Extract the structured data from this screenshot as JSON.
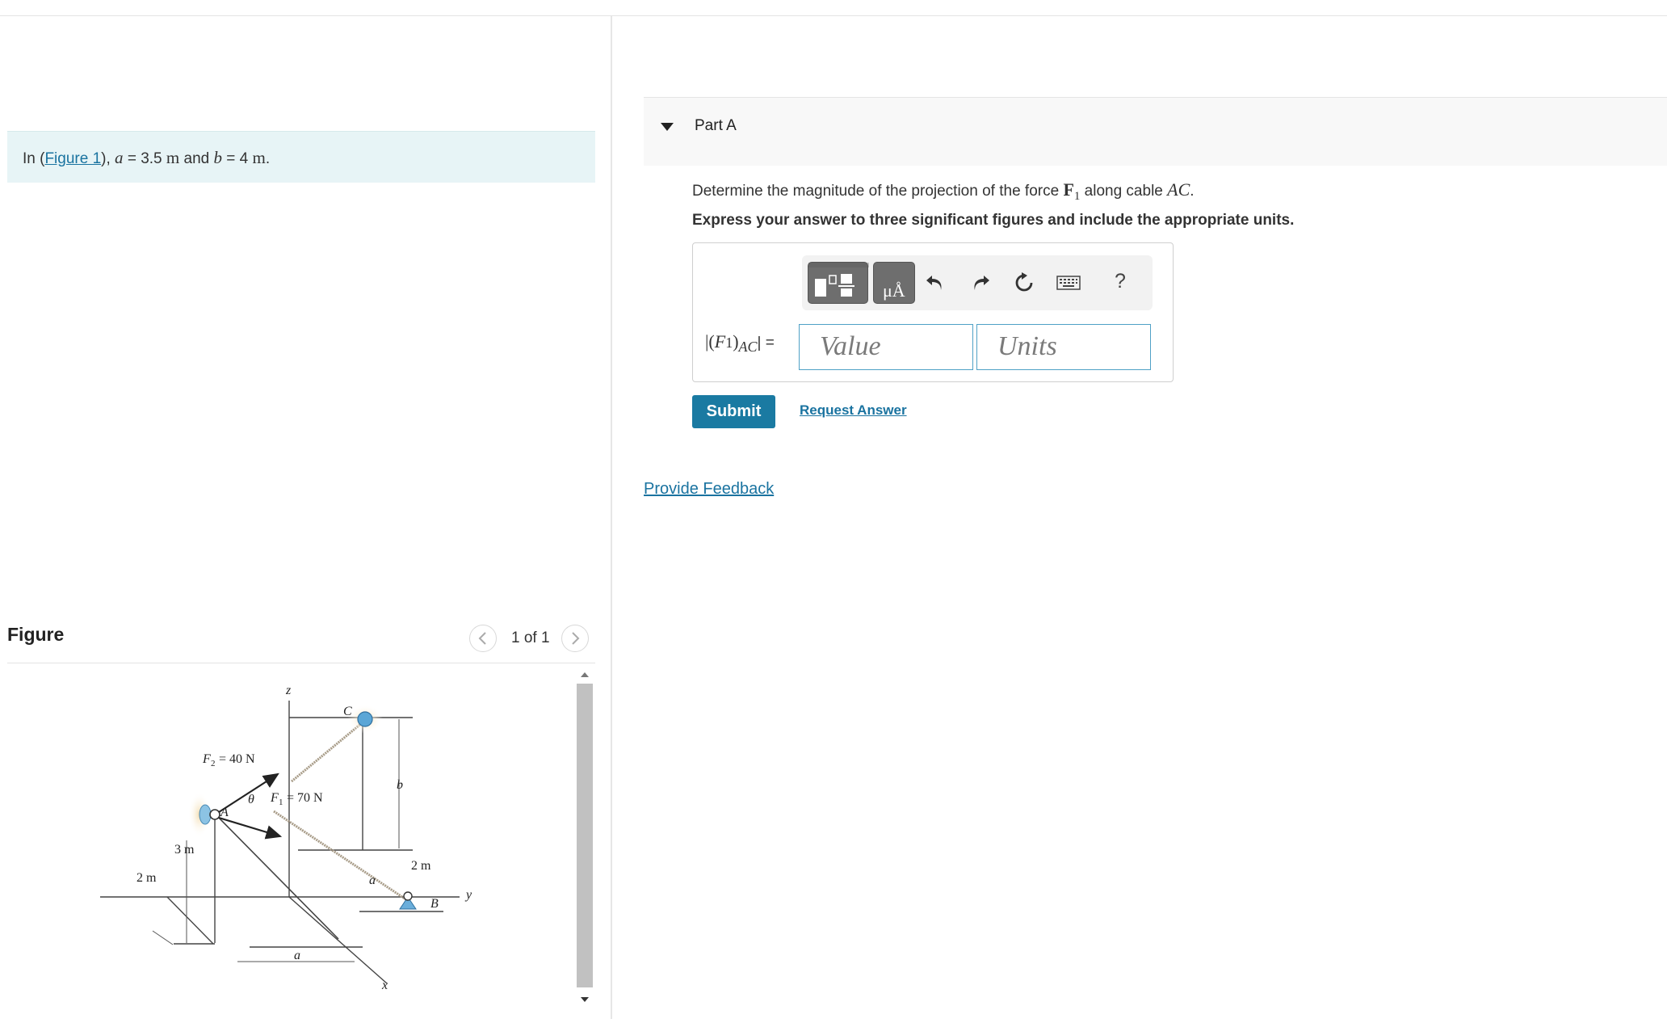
{
  "intro": {
    "prefix": "In (",
    "figure_link": "Figure 1",
    "mid1": "), ",
    "a_sym": "a",
    "eq_a": " = 3.5 ",
    "unit_a": "m",
    "and_text": " and ",
    "b_sym": "b",
    "eq_b": " = 4 ",
    "unit_b": "m",
    "end": "."
  },
  "figure": {
    "title": "Figure",
    "counter": "1 of 1",
    "labels": {
      "z": "z",
      "c": "C",
      "f2": "= 40 N",
      "f2_sym": "F",
      "f2_sub": "2",
      "b": "b",
      "theta": "θ",
      "f1_sym": "F",
      "f1_sub": "1",
      "f1": "= 70 N",
      "a_point": "A",
      "three_m": "3 m",
      "two_m_right": "2 m",
      "y": "y",
      "b_point": "B",
      "two_m_left": "2 m",
      "a_dim_right": "a",
      "a_dim_bottom": "a",
      "x": "x"
    }
  },
  "part_a": {
    "title": "Part A",
    "question_prefix": "Determine the magnitude of the projection of the force ",
    "force_sym": "F",
    "force_sub": "1",
    "question_mid": " along cable ",
    "cable": "AC",
    "question_end": ".",
    "instructions": "Express your answer to three significant figures and include the appropriate units.",
    "eq_label_pre": "|(",
    "eq_label_f": "F",
    "eq_label_sub1": "1",
    "eq_label_mid": ")",
    "eq_label_sub2": "AC",
    "eq_label_post": "| =",
    "value_placeholder": "Value",
    "units_placeholder": "Units",
    "toolbar_units_label": "μÅ",
    "help": "?",
    "submit": "Submit",
    "request_answer": "Request Answer"
  },
  "feedback": "Provide Feedback",
  "colors": {
    "accent": "#1a7aa2",
    "link": "#1a73a0",
    "intro_bg": "#e7f4f6",
    "input_border": "#4fa1c6"
  }
}
